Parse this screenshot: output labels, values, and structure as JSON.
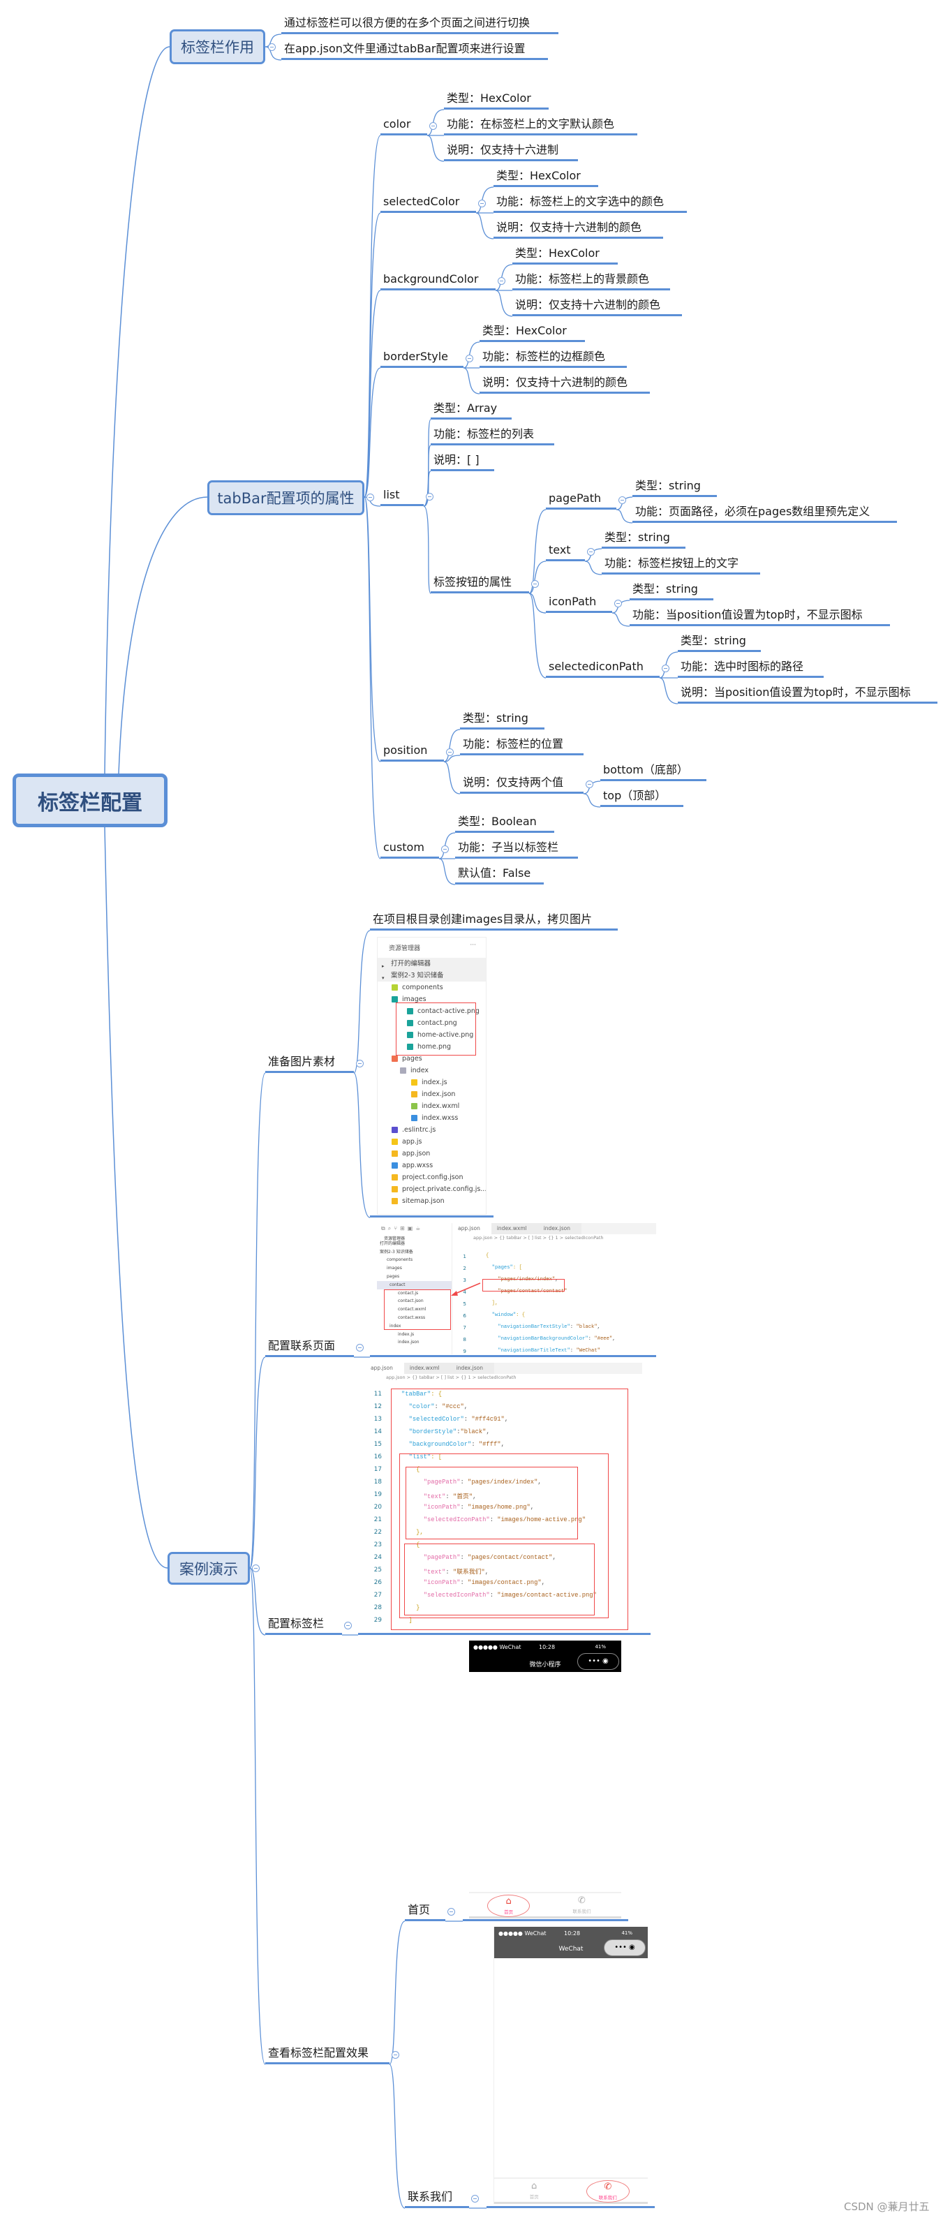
{
  "mindmap": {
    "root": "标签栏配置",
    "purpose": {
      "label": "标签栏作用",
      "items": [
        "通过标签栏可以很方便的在多个页面之间进行切换",
        "在app.json文件里通过tabBar配置项来进行设置"
      ]
    },
    "props": {
      "label": "tabBar配置项的属性",
      "color": {
        "label": "color",
        "items": [
          "类型：HexColor",
          "功能：在标签栏上的文字默认颜色",
          "说明：仅支持十六进制"
        ]
      },
      "selectedColor": {
        "label": "selectedColor",
        "items": [
          "类型：HexColor",
          "功能：标签栏上的文字选中的颜色",
          "说明：仅支持十六进制的颜色"
        ]
      },
      "backgroundColor": {
        "label": "backgroundColor",
        "items": [
          "类型：HexColor",
          "功能：标签栏上的背景颜色",
          "说明：仅支持十六进制的颜色"
        ]
      },
      "borderStyle": {
        "label": "borderStyle",
        "items": [
          "类型：HexColor",
          "功能：标签栏的边框颜色",
          "说明：仅支持十六进制的颜色"
        ]
      },
      "list": {
        "label": "list",
        "items": [
          "类型：Array",
          "功能：标签栏的列表",
          "说明：[ ]"
        ],
        "button_props": {
          "label": "标签按钮的属性",
          "pagePath": {
            "label": "pagePath",
            "items": [
              "类型：string",
              "功能：页面路径，必须在pages数组里预先定义"
            ]
          },
          "text": {
            "label": "text",
            "items": [
              "类型：string",
              "功能：标签栏按钮上的文字"
            ]
          },
          "iconPath": {
            "label": "iconPath",
            "items": [
              "类型：string",
              "功能：当position值设置为top时，不显示图标"
            ]
          },
          "selectediconPath": {
            "label": "selectediconPath",
            "items": [
              "类型：string",
              "功能：选中时图标的路径",
              "说明：当position值设置为top时，不显示图标"
            ]
          }
        }
      },
      "position": {
        "label": "position",
        "items": [
          "类型：string",
          "功能：标签栏的位置",
          "说明：仅支持两个值"
        ],
        "values": [
          "bottom（底部）",
          "top（顶部）"
        ]
      },
      "custom": {
        "label": "custom",
        "items": [
          "类型：Boolean",
          "功能：子当以标签栏",
          "默认值：False"
        ]
      }
    },
    "demo": {
      "label": "案例演示",
      "prepare": {
        "label": "准备图片素材",
        "note": "在项目根目录创建images目录从，拷贝图片"
      },
      "contact_page": {
        "label": "配置联系页面"
      },
      "tabbar": {
        "label": "配置标签栏"
      },
      "effect": {
        "label": "查看标签栏配置效果",
        "home": "首页",
        "contact": "联系我们"
      }
    }
  },
  "explorer": {
    "title": "资源管理器",
    "more": "···",
    "rows": [
      {
        "label": "打开的编辑器",
        "icon": "caret-right"
      },
      {
        "label": "案例2-3 知识储备",
        "icon": "caret-down"
      },
      {
        "label": "components",
        "icon": "folder-green"
      },
      {
        "label": "images",
        "icon": "folder-teal"
      },
      {
        "label": "contact-active.png",
        "icon": "image-file"
      },
      {
        "label": "contact.png",
        "icon": "image-file"
      },
      {
        "label": "home-active.png",
        "icon": "image-file"
      },
      {
        "label": "home.png",
        "icon": "image-file"
      },
      {
        "label": "pages",
        "icon": "folder-red"
      },
      {
        "label": "index",
        "icon": "folder-gray"
      },
      {
        "label": "index.js",
        "icon": "js-file"
      },
      {
        "label": "index.json",
        "icon": "json-file"
      },
      {
        "label": "index.wxml",
        "icon": "wxml-file"
      },
      {
        "label": "index.wxss",
        "icon": "wxss-file"
      },
      {
        "label": ".eslintrc.js",
        "icon": "eslint-file"
      },
      {
        "label": "app.js",
        "icon": "js-file"
      },
      {
        "label": "app.json",
        "icon": "json-file"
      },
      {
        "label": "app.wxss",
        "icon": "wxss-file"
      },
      {
        "label": "project.config.json",
        "icon": "json-file"
      },
      {
        "label": "project.private.config.js...",
        "icon": "json-file"
      },
      {
        "label": "sitemap.json",
        "icon": "json-file"
      }
    ]
  },
  "editor_contact": {
    "tabs": [
      "app.json",
      "index.wxml",
      "index.json"
    ],
    "breadcrumb": "app.json > {} tabBar > [ ] list > {} 1 > selectedIconPath",
    "tree": [
      "资源管理器",
      "打开的编辑器",
      "案例2-3 知识储备",
      "components",
      "images",
      "pages",
      "contact",
      "contact.js",
      "contact.json",
      "contact.wxml",
      "contact.wxss",
      "index",
      "index.js",
      "index.json"
    ],
    "lines": [
      {
        "n": "1",
        "t": "{"
      },
      {
        "n": "2",
        "t": "  \"pages\": ["
      },
      {
        "n": "3",
        "t": "    \"pages/index/index\","
      },
      {
        "n": "4",
        "t": "    \"pages/contact/contact\""
      },
      {
        "n": "5",
        "t": "  ],"
      },
      {
        "n": "6",
        "t": "  \"window\": {"
      },
      {
        "n": "7",
        "t": "    \"navigationBarTextStyle\": \"black\","
      },
      {
        "n": "8",
        "t": "    \"navigationBarBackgroundColor\": \"#eee\","
      },
      {
        "n": "9",
        "t": "    \"navigationBarTitleText\": \"WeChat\""
      }
    ]
  },
  "editor_tabbar": {
    "tabs": [
      "app.json",
      "index.wxml",
      "index.json"
    ],
    "breadcrumb": "app.json > {} tabBar > [ ] list > {} 1 > selectedIconPath",
    "lines": [
      {
        "n": "11",
        "t": "\"tabBar\": {"
      },
      {
        "n": "12",
        "t": "  \"color\": \"#ccc\","
      },
      {
        "n": "13",
        "t": "  \"selectedColor\": \"#ff4c91\","
      },
      {
        "n": "14",
        "t": "  \"borderStyle\":\"black\","
      },
      {
        "n": "15",
        "t": "  \"backgroundColor\": \"#fff\","
      },
      {
        "n": "16",
        "t": "  \"list\": ["
      },
      {
        "n": "17",
        "t": "    {"
      },
      {
        "n": "18",
        "t": "      \"pagePath\": \"pages/index/index\","
      },
      {
        "n": "19",
        "t": "      \"text\": \"首页\","
      },
      {
        "n": "20",
        "t": "      \"iconPath\": \"images/home.png\","
      },
      {
        "n": "21",
        "t": "      \"selectedIconPath\": \"images/home-active.png\""
      },
      {
        "n": "22",
        "t": "    },"
      },
      {
        "n": "23",
        "t": "    {"
      },
      {
        "n": "24",
        "t": "      \"pagePath\": \"pages/contact/contact\","
      },
      {
        "n": "25",
        "t": "      \"text\": \"联系我们\","
      },
      {
        "n": "26",
        "t": "      \"iconPath\": \"images/contact.png\","
      },
      {
        "n": "27",
        "t": "      \"selectedIconPath\": \"images/contact-active.png\""
      },
      {
        "n": "28",
        "t": "    }"
      },
      {
        "n": "29",
        "t": "  ]"
      }
    ]
  },
  "phone_home": {
    "carrier": "●●●●● WeChat",
    "time": "10:28",
    "battery": "41%",
    "title": "微信小程序",
    "tabs": [
      "首页",
      "联系我们"
    ],
    "active_tab": 0,
    "header_color": "#000000"
  },
  "phone_contact": {
    "carrier": "●●●●● WeChat",
    "time": "10:28",
    "battery": "41%",
    "title": "WeChat",
    "tabs": [
      "首页",
      "联系我们"
    ],
    "active_tab": 1,
    "header_color": "#555555"
  },
  "colors": {
    "line": "#5b8fd6",
    "box_fill": "#dbe5f3",
    "highlight": "#f04848",
    "selected_tab": "#ff4c91"
  },
  "watermark": "CSDN @蒹月廿五"
}
